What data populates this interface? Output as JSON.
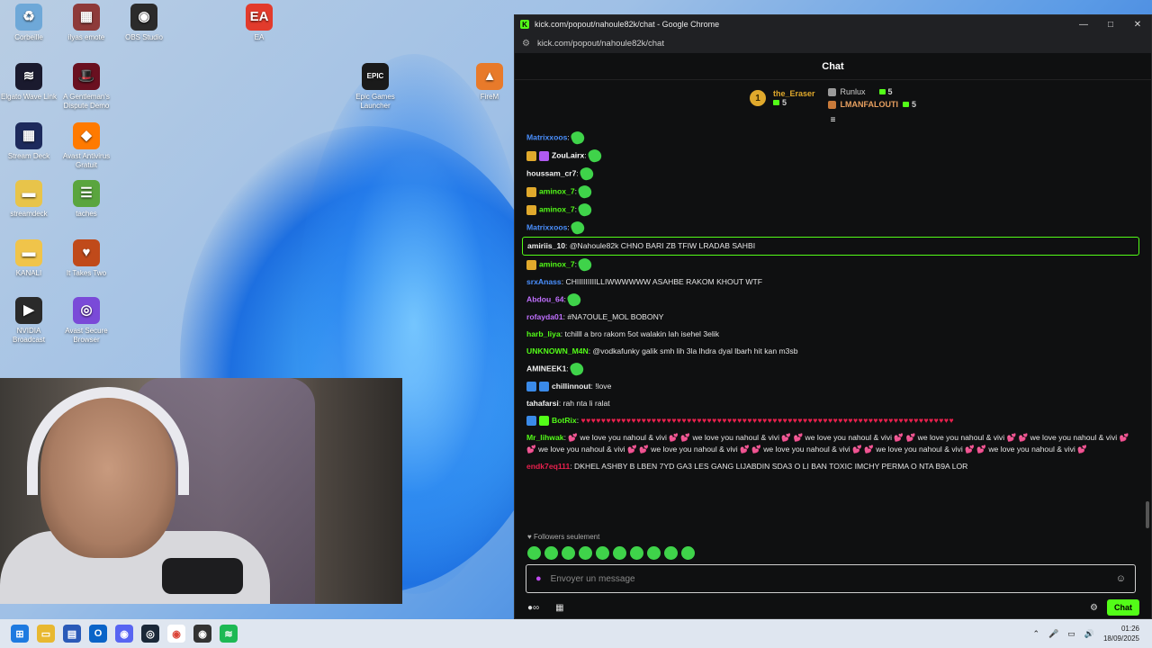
{
  "desktop": {
    "icons": [
      {
        "label": "Corbeille",
        "glyph": "♻",
        "color": "#6ea8d8"
      },
      {
        "label": "ilyas emote",
        "glyph": "▦",
        "color": "#8e3a3a"
      },
      {
        "label": "OBS Studio",
        "glyph": "◉",
        "color": "#2b2b2b"
      },
      {
        "label": "EA",
        "glyph": "EA",
        "color": "#e23b2c"
      },
      {
        "label": "Elgato Wave Link",
        "glyph": "≋",
        "color": "#1a1a2e"
      },
      {
        "label": "A Gentleman's Dispute Demo",
        "glyph": "🎩",
        "color": "#6a1020"
      },
      {
        "label": "Epic Games Launcher",
        "glyph": "EPIC",
        "color": "#1a1a1a"
      },
      {
        "label": "FireM",
        "glyph": "▲",
        "color": "#e87a2a"
      },
      {
        "label": "Stream Deck",
        "glyph": "▦",
        "color": "#1d2a5c"
      },
      {
        "label": "Avast Antivirus Gratuit",
        "glyph": "◆",
        "color": "#ff7a00"
      },
      {
        "label": "streamdeck",
        "glyph": "▬",
        "color": "#e8c44a"
      },
      {
        "label": "taches",
        "glyph": "☰",
        "color": "#5aa53e"
      },
      {
        "label": "KANALI",
        "glyph": "▬",
        "color": "#f0c44a"
      },
      {
        "label": "It Takes Two",
        "glyph": "♥",
        "color": "#c04a1a"
      },
      {
        "label": "NVIDIA Broadcast",
        "glyph": "▶",
        "color": "#2a2a2a"
      },
      {
        "label": "Avast Secure Browser",
        "glyph": "◎",
        "color": "#7a4ad8"
      }
    ]
  },
  "window": {
    "title": "kick.com/popout/nahoule82k/chat - Google Chrome",
    "url": "kick.com/popout/nahoule82k/chat",
    "controls": {
      "min": "—",
      "max": "□",
      "close": "✕"
    }
  },
  "chat": {
    "header": "Chat",
    "gifters": {
      "first": {
        "name": "the_Eraser",
        "count": "5",
        "rank": "1"
      },
      "second": {
        "name": "Runlux",
        "count": "5"
      },
      "third": {
        "name": "LMANFALOUTI",
        "count": "5"
      }
    },
    "pin_icon": "≡",
    "messages": [
      {
        "user": "Matrixxoos",
        "color": "#4a90ff",
        "text": "",
        "emote": true
      },
      {
        "user": "ZouLairx",
        "color": "#ffffff",
        "text": "",
        "emote": true,
        "badges": [
          "#e0a92c",
          "#b05af0"
        ]
      },
      {
        "user": "houssam_cr7",
        "color": "#f0f0f0",
        "text": "",
        "emote": true
      },
      {
        "user": "aminox_7",
        "color": "#53fc18",
        "text": "",
        "emote": true,
        "badges": [
          "#e0a92c"
        ]
      },
      {
        "user": "aminox_7",
        "color": "#53fc18",
        "text": "",
        "emote": true,
        "badges": [
          "#e0a92c"
        ]
      },
      {
        "user": "Matrixxoos",
        "color": "#4a90ff",
        "text": "",
        "emote": true
      },
      {
        "user": "amiriis_10",
        "color": "#f0f0f0",
        "text": "@Nahoule82k CHNO BARI ZB TFIW LRADAB SAHBI",
        "highlight": true
      },
      {
        "user": "aminox_7",
        "color": "#53fc18",
        "text": "",
        "emote": true,
        "badges": [
          "#e0a92c"
        ]
      },
      {
        "user": "srxAnass",
        "color": "#4a90ff",
        "text": "CHIIIIIIIIILLIWWWWWW ASAHBE RAKOM KHOUT WTF"
      },
      {
        "user": "Abdou_64",
        "color": "#c070ff",
        "text": "",
        "emote": true
      },
      {
        "user": "rofayda01",
        "color": "#c070ff",
        "text": "#NA7OULE_MOL BOBONY"
      },
      {
        "user": "harb_liya",
        "color": "#53fc18",
        "text": "tchilll a bro rakom 5ot walakin lah isehel 3elik"
      },
      {
        "user": "UNKNOWN_M4N",
        "color": "#53fc18",
        "text": "@vodkafunky galik smh lih 3la lhdra dyal lbarh hit kan m3sb"
      },
      {
        "user": "AMINEEK1",
        "color": "#f0f0f0",
        "text": "",
        "emote": true
      },
      {
        "user": "chillinnout",
        "color": "#f0f0f0",
        "text": "!love",
        "badges": [
          "#3a8ae8",
          "#3a8ae8"
        ]
      },
      {
        "user": "tahafarsi",
        "color": "#f0f0f0",
        "text": "rah nta li ralat"
      },
      {
        "user": "BotRix",
        "color": "#53fc18",
        "text": "♥♥♥♥♥♥♥♥♥♥♥♥♥♥♥♥♥♥♥♥♥♥♥♥♥♥♥♥♥♥♥♥♥♥♥♥♥♥♥♥♥♥♥♥♥♥♥♥♥♥♥♥♥♥♥♥♥♥♥♥♥♥♥♥♥♥♥♥♥♥♥♥♥♥",
        "hearts": true,
        "badges": [
          "#3a8ae8",
          "#53fc18"
        ]
      },
      {
        "user": "Mr_lihwak",
        "color": "#53fc18",
        "text": "💕 we love you nahoul & vivi 💕 💕 we love you nahoul & vivi 💕 💕 we love you nahoul & vivi 💕 💕 we love you nahoul & vivi 💕 💕 we love you nahoul & vivi 💕 💕 we love you nahoul & vivi 💕 💕 we love you nahoul & vivi 💕 💕 we love you nahoul & vivi 💕 💕 we love you nahoul & vivi 💕 💕 we love you nahoul & vivi 💕"
      },
      {
        "user": "endk7eq111",
        "color": "#e8204d",
        "text": "DKHEL ASHBY B LBEN 7YD GA3 LES GANG LIJABDIN SDA3 O LI BAN TOXIC IMCHY PERMA O NTA B9A LOR"
      }
    ],
    "followers_only": "♥ Followers seulement",
    "input_placeholder": "Envoyer un message",
    "send_label": "Chat"
  },
  "taskbar": {
    "time": "01:26",
    "date": "18/09/2025"
  }
}
